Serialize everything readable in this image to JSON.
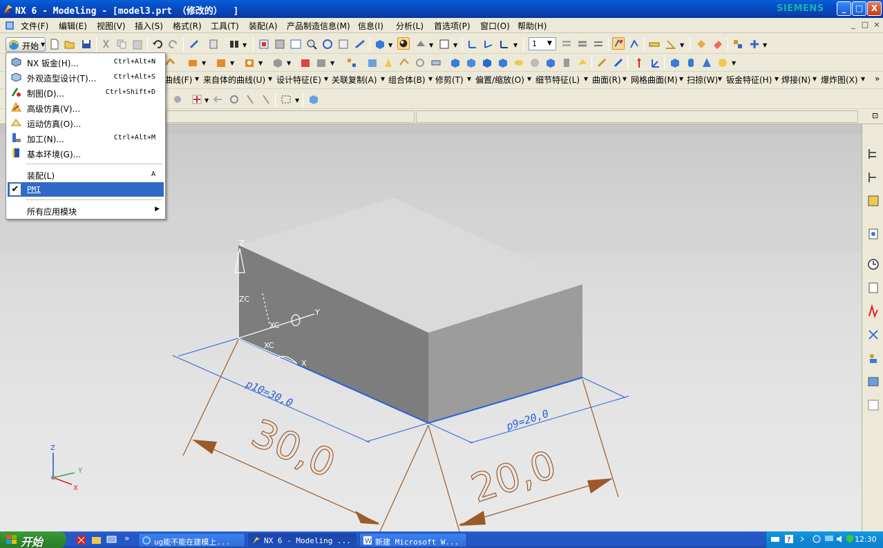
{
  "window": {
    "title": "NX 6 - Modeling - [model3.prt （修改的）  ]",
    "brand": "SIEMENS",
    "buttons": {
      "minimize": "_",
      "maximize": "□",
      "close": "X"
    }
  },
  "menubar": {
    "items": [
      "文件(F)",
      "编辑(E)",
      "视图(V)",
      "插入(S)",
      "格式(R)",
      "工具(T)",
      "装配(A)",
      "产品制造信息(M)",
      "信息(I)",
      "分析(L)",
      "首选项(P)",
      "窗口(O)",
      "帮助(H)"
    ],
    "mdi": [
      "_",
      "□",
      "×"
    ]
  },
  "toolbar": {
    "start_label": "开始",
    "layer_value": "1"
  },
  "command_bar": {
    "items": [
      "曲线(F)",
      "来自体的曲线(U)",
      "设计特征(E)",
      "关联复制(A)",
      "组合体(B)",
      "修剪(T)",
      "偏置/缩放(O)",
      "细节特征(L)",
      "曲面(R)",
      "网格曲面(M)",
      "扫掠(W)",
      "钣金特征(H)",
      "焊接(N)",
      "爆炸图(X)"
    ]
  },
  "start_menu": {
    "items": [
      {
        "label": "NX 钣金(H)...",
        "shortcut": "Ctrl+Alt+N",
        "icon": "sheet-metal-icon"
      },
      {
        "label": "外观造型设计(T)...",
        "shortcut": "Ctrl+Alt+S",
        "icon": "shape-studio-icon"
      },
      {
        "label": "制图(D)...",
        "shortcut": "Ctrl+Shift+D",
        "icon": "drafting-icon"
      },
      {
        "label": "高级仿真(V)...",
        "shortcut": "",
        "icon": "advanced-simulation-icon"
      },
      {
        "label": "运动仿真(O)...",
        "shortcut": "",
        "icon": "motion-simulation-icon"
      },
      {
        "label": "加工(N)...",
        "shortcut": "Ctrl+Alt+M",
        "icon": "manufacturing-icon"
      },
      {
        "label": "基本环境(G)...",
        "shortcut": "",
        "icon": "gateway-icon"
      }
    ],
    "assembly": {
      "label": "装配(L)",
      "shortcut": "A"
    },
    "pmi": {
      "label": "PMI",
      "checked": true
    },
    "all_apps": {
      "label": "所有应用模块"
    }
  },
  "graphics": {
    "dims": {
      "d1_label": "p10=30,0",
      "d2_label": "p9=20,0",
      "big1": "30,0",
      "big2": "20,0"
    },
    "csys_labels": {
      "z": "Z",
      "zc": "ZC",
      "y": "Y",
      "xc1": "XC",
      "xc2": "XC",
      "x": "X"
    },
    "triad": {
      "z": "Z",
      "y": "Y",
      "x": "X"
    }
  },
  "taskbar": {
    "start_label": "开始",
    "tasks": [
      {
        "label": "ug能不能在建模上...",
        "icon": "ie-icon"
      },
      {
        "label": "NX 6 - Modeling ...",
        "icon": "nx-icon"
      },
      {
        "label": "新建 Microsoft W...",
        "icon": "word-icon"
      }
    ],
    "clock": "12:30",
    "chevron": "»"
  },
  "colors": {
    "dimension": "#9b5a2a",
    "edge_highlight": "#2a5fd8",
    "selection": "#316ac5",
    "title_gradient": "#0a5fd8"
  }
}
